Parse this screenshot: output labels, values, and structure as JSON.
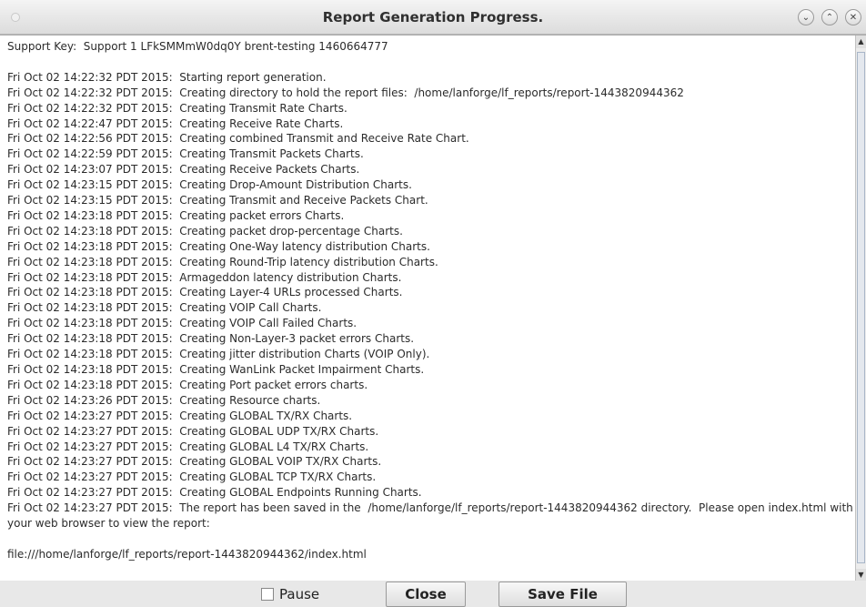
{
  "window": {
    "title": "Report Generation Progress."
  },
  "log": {
    "lines": [
      "Support Key:  Support 1 LFkSMMmW0dq0Y brent-testing 1460664777",
      "",
      "Fri Oct 02 14:22:32 PDT 2015:  Starting report generation.",
      "Fri Oct 02 14:22:32 PDT 2015:  Creating directory to hold the report files:  /home/lanforge/lf_reports/report-1443820944362",
      "Fri Oct 02 14:22:32 PDT 2015:  Creating Transmit Rate Charts.",
      "Fri Oct 02 14:22:47 PDT 2015:  Creating Receive Rate Charts.",
      "Fri Oct 02 14:22:56 PDT 2015:  Creating combined Transmit and Receive Rate Chart.",
      "Fri Oct 02 14:22:59 PDT 2015:  Creating Transmit Packets Charts.",
      "Fri Oct 02 14:23:07 PDT 2015:  Creating Receive Packets Charts.",
      "Fri Oct 02 14:23:15 PDT 2015:  Creating Drop-Amount Distribution Charts.",
      "Fri Oct 02 14:23:15 PDT 2015:  Creating Transmit and Receive Packets Chart.",
      "Fri Oct 02 14:23:18 PDT 2015:  Creating packet errors Charts.",
      "Fri Oct 02 14:23:18 PDT 2015:  Creating packet drop-percentage Charts.",
      "Fri Oct 02 14:23:18 PDT 2015:  Creating One-Way latency distribution Charts.",
      "Fri Oct 02 14:23:18 PDT 2015:  Creating Round-Trip latency distribution Charts.",
      "Fri Oct 02 14:23:18 PDT 2015:  Armageddon latency distribution Charts.",
      "Fri Oct 02 14:23:18 PDT 2015:  Creating Layer-4 URLs processed Charts.",
      "Fri Oct 02 14:23:18 PDT 2015:  Creating VOIP Call Charts.",
      "Fri Oct 02 14:23:18 PDT 2015:  Creating VOIP Call Failed Charts.",
      "Fri Oct 02 14:23:18 PDT 2015:  Creating Non-Layer-3 packet errors Charts.",
      "Fri Oct 02 14:23:18 PDT 2015:  Creating jitter distribution Charts (VOIP Only).",
      "Fri Oct 02 14:23:18 PDT 2015:  Creating WanLink Packet Impairment Charts.",
      "Fri Oct 02 14:23:18 PDT 2015:  Creating Port packet errors charts.",
      "Fri Oct 02 14:23:26 PDT 2015:  Creating Resource charts.",
      "Fri Oct 02 14:23:27 PDT 2015:  Creating GLOBAL TX/RX Charts.",
      "Fri Oct 02 14:23:27 PDT 2015:  Creating GLOBAL UDP TX/RX Charts.",
      "Fri Oct 02 14:23:27 PDT 2015:  Creating GLOBAL L4 TX/RX Charts.",
      "Fri Oct 02 14:23:27 PDT 2015:  Creating GLOBAL VOIP TX/RX Charts.",
      "Fri Oct 02 14:23:27 PDT 2015:  Creating GLOBAL TCP TX/RX Charts.",
      "Fri Oct 02 14:23:27 PDT 2015:  Creating GLOBAL Endpoints Running Charts.",
      "Fri Oct 02 14:23:27 PDT 2015:  The report has been saved in the  /home/lanforge/lf_reports/report-1443820944362 directory.  Please open index.html with your web browser to view the report:",
      "",
      "file:///home/lanforge/lf_reports/report-1443820944362/index.html"
    ]
  },
  "controls": {
    "pause_label": "Pause",
    "pause_checked": false,
    "close_label": "Close",
    "save_label": "Save File"
  },
  "icons": {
    "window_menu": "window-menu-icon",
    "minimize": "minimize-icon",
    "maximize": "maximize-icon",
    "close": "close-icon"
  }
}
